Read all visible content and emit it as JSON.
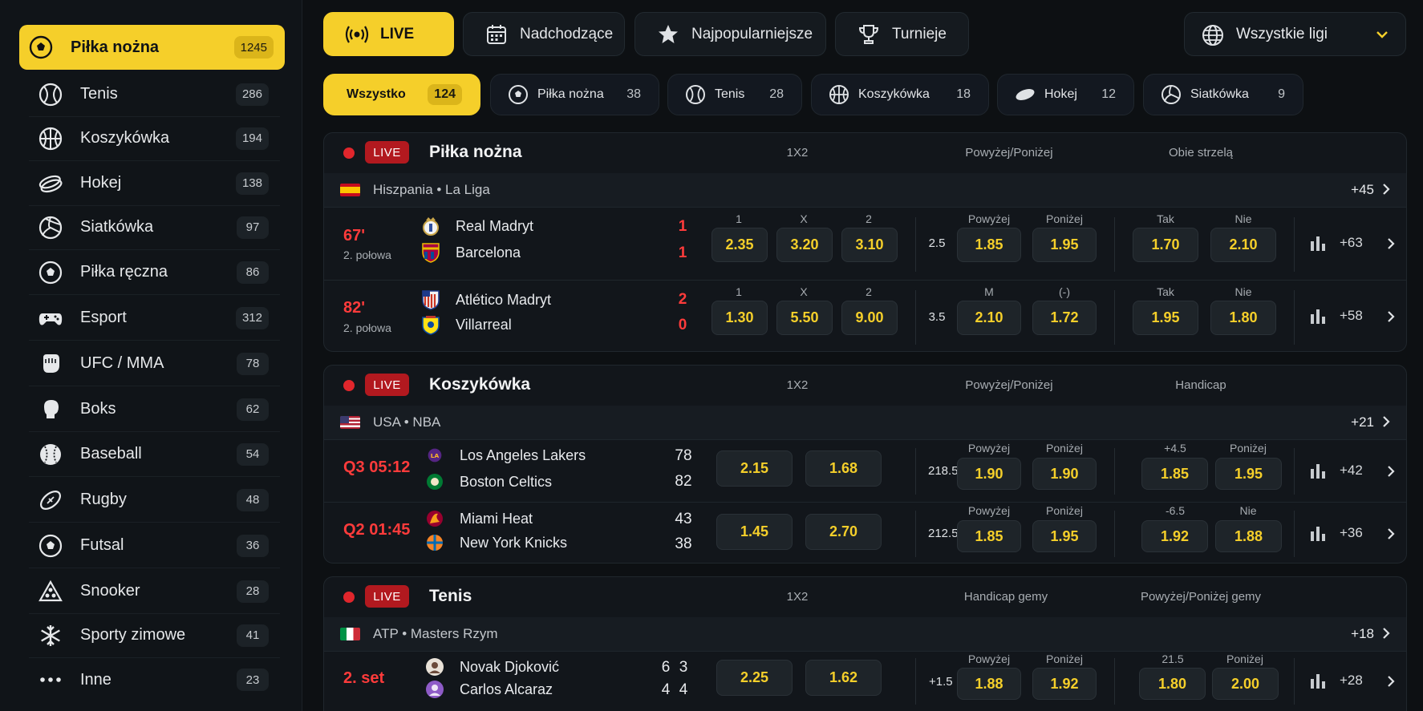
{
  "colors": {
    "accent": "#f5cf2a",
    "live": "#e0262c",
    "odds": "#f5cf2a"
  },
  "sidebar": {
    "items": [
      {
        "label": "Piłka nożna",
        "count": "1245",
        "icon": "soccer-ball-icon"
      },
      {
        "label": "Tenis",
        "count": "286",
        "icon": "tennis-ball-icon"
      },
      {
        "label": "Koszykówka",
        "count": "194",
        "icon": "basketball-icon"
      },
      {
        "label": "Hokej",
        "count": "138",
        "icon": "hockey-puck-icon"
      },
      {
        "label": "Siatkówka",
        "count": "97",
        "icon": "volleyball-icon"
      },
      {
        "label": "Piłka ręczna",
        "count": "86",
        "icon": "handball-icon"
      },
      {
        "label": "Esport",
        "count": "312",
        "icon": "gamepad-icon"
      },
      {
        "label": "UFC / MMA",
        "count": "78",
        "icon": "mma-glove-icon"
      },
      {
        "label": "Boks",
        "count": "62",
        "icon": "boxing-glove-icon"
      },
      {
        "label": "Baseball",
        "count": "54",
        "icon": "baseball-icon"
      },
      {
        "label": "Rugby",
        "count": "48",
        "icon": "rugby-ball-icon"
      },
      {
        "label": "Futsal",
        "count": "36",
        "icon": "futsal-ball-icon"
      },
      {
        "label": "Snooker",
        "count": "28",
        "icon": "snooker-icon"
      },
      {
        "label": "Sporty zimowe",
        "count": "41",
        "icon": "snowflake-icon"
      },
      {
        "label": "Inne",
        "count": "23",
        "icon": "more-dots-icon"
      }
    ]
  },
  "tabs": [
    {
      "label": "LIVE",
      "icon": "live-broadcast-icon"
    },
    {
      "label": "Nadchodzące",
      "icon": "calendar-icon"
    },
    {
      "label": "Najpopularniejsze",
      "icon": "star-icon"
    },
    {
      "label": "Turnieje",
      "icon": "trophy-icon"
    }
  ],
  "league_select": {
    "label": "Wszystkie ligi",
    "icon": "globe-icon"
  },
  "chips": [
    {
      "label": "Wszystko",
      "count": "124"
    },
    {
      "label": "Piłka nożna",
      "count": "38"
    },
    {
      "label": "Tenis",
      "count": "28"
    },
    {
      "label": "Koszykówka",
      "count": "18"
    },
    {
      "label": "Hokej",
      "count": "12"
    },
    {
      "label": "Siatkówka",
      "count": "9"
    }
  ],
  "live_label": "LIVE",
  "sections": [
    {
      "title": "Piłka nożna",
      "markets": [
        "1X2",
        "Powyżej/Poniżej",
        "Obie strzelą"
      ],
      "league": {
        "name": "Hiszpania • La Liga",
        "more": "+45"
      },
      "matches": [
        {
          "time": "67'",
          "phase": "2. połowa",
          "team1": "Real Madryt",
          "team2": "Barcelona",
          "score1": "1",
          "score2": "1",
          "l1": [
            "1",
            "X",
            "2"
          ],
          "o1": [
            "2.35",
            "3.20",
            "3.10"
          ],
          "line": "2.5",
          "l2": [
            "Powyżej",
            "Poniżej"
          ],
          "o2": [
            "1.85",
            "1.95"
          ],
          "l3": [
            "Tak",
            "Nie"
          ],
          "o3": [
            "1.70",
            "2.10"
          ],
          "more": "+63"
        },
        {
          "time": "82'",
          "phase": "2. połowa",
          "team1": "Atlético Madryt",
          "team2": "Villarreal",
          "score1": "2",
          "score2": "0",
          "l1": [
            "1",
            "X",
            "2"
          ],
          "o1": [
            "1.30",
            "5.50",
            "9.00"
          ],
          "line": "3.5",
          "l2": [
            "M",
            "(-)"
          ],
          "o2": [
            "2.10",
            "1.72"
          ],
          "l3": [
            "Tak",
            "Nie"
          ],
          "o3": [
            "1.95",
            "1.80"
          ],
          "more": "+58"
        }
      ]
    },
    {
      "title": "Koszykówka",
      "markets": [
        "1X2",
        "Powyżej/Poniżej",
        "Handicap"
      ],
      "league": {
        "name": "USA • NBA",
        "more": "+21"
      },
      "matches": [
        {
          "time": "Q3  05:12",
          "team1": "Los Angeles Lakers",
          "team2": "Boston Celtics",
          "score1": "78",
          "score2": "82",
          "o1": [
            "2.15",
            "1.68"
          ],
          "line": "218.5",
          "l2": [
            "Powyżej",
            "Poniżej"
          ],
          "o2": [
            "1.90",
            "1.90"
          ],
          "l3": [
            "+4.5",
            "Poniżej"
          ],
          "o3": [
            "1.85",
            "1.95"
          ],
          "more": "+42"
        },
        {
          "time": "Q2  01:45",
          "team1": "Miami Heat",
          "team2": "New York Knicks",
          "score1": "43",
          "score2": "38",
          "o1": [
            "1.45",
            "2.70"
          ],
          "line": "212.5",
          "l2": [
            "Powyżej",
            "Poniżej"
          ],
          "o2": [
            "1.85",
            "1.95"
          ],
          "l3": [
            "-6.5",
            "Nie"
          ],
          "o3": [
            "1.92",
            "1.88"
          ],
          "more": "+36"
        }
      ]
    },
    {
      "title": "Tenis",
      "markets": [
        "1X2",
        "Handicap gemy",
        "Powyżej/Poniżej gemy"
      ],
      "league": {
        "name": "ATP • Masters Rzym",
        "more": "+18"
      },
      "matches": [
        {
          "time": "2. set",
          "team1": "Novak Djoković",
          "team2": "Carlos Alcaraz",
          "s1a": "6",
          "s1b": "3",
          "s2a": "4",
          "s2b": "4",
          "o1": [
            "2.25",
            "1.62"
          ],
          "line": "+1.5",
          "l2": [
            "Powyżej",
            "Poniżej"
          ],
          "o2": [
            "1.88",
            "1.92"
          ],
          "l3": [
            "21.5",
            "Poniżej"
          ],
          "o3": [
            "1.80",
            "2.00"
          ],
          "more": "+28"
        }
      ]
    }
  ]
}
